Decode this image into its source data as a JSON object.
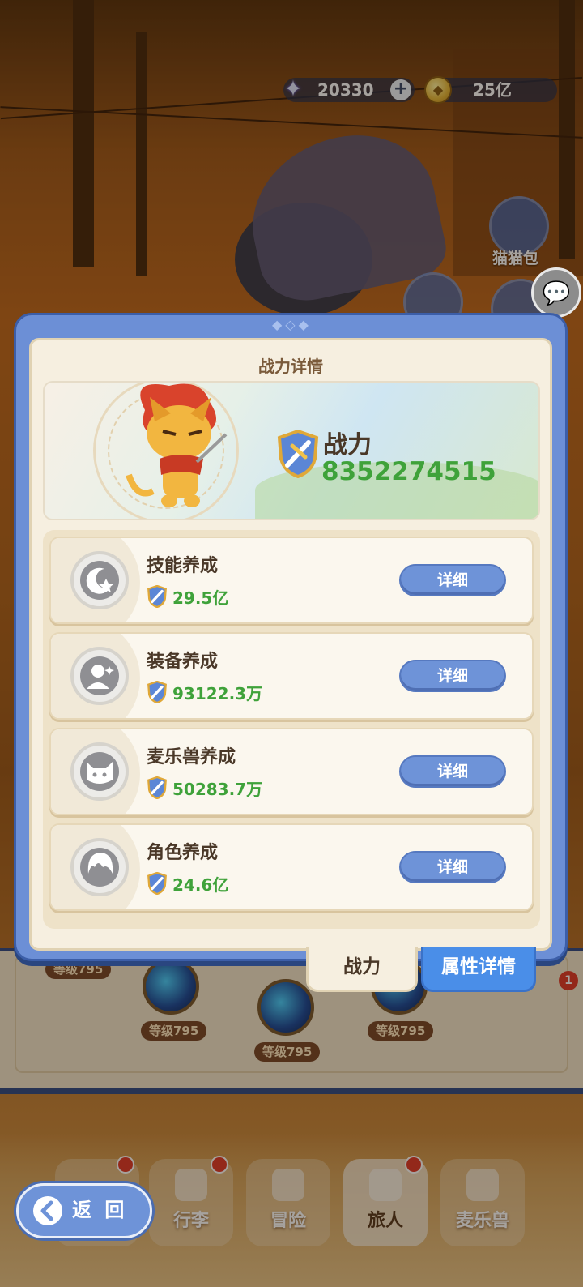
{
  "currency": {
    "gems": "20330",
    "gold": "25亿",
    "gem_icon": "star-gem-icon",
    "gold_icon": "gold-coin-icon"
  },
  "side_menu": {
    "cat_bag_label": "猫猫包"
  },
  "dialog": {
    "title": "战力详情",
    "power_label": "战力",
    "power_value": "8352274515",
    "rows": [
      {
        "name": "技能养成",
        "value": "29.5亿",
        "button": "详细",
        "icon": "moon-star-icon"
      },
      {
        "name": "装备养成",
        "value": "93122.3万",
        "button": "详细",
        "icon": "equipment-figure-icon"
      },
      {
        "name": "麦乐兽养成",
        "value": "50283.7万",
        "button": "详细",
        "icon": "beast-cat-icon"
      },
      {
        "name": "角色养成",
        "value": "24.6亿",
        "button": "详细",
        "icon": "character-head-icon"
      }
    ]
  },
  "dialog_tabs": {
    "power": "战力",
    "attributes": "属性详情"
  },
  "background": {
    "levels": [
      "等级795",
      "等级795",
      "等级795",
      "等级795"
    ],
    "badge_count": "1"
  },
  "back_button": "返 回",
  "tabbar": {
    "items": [
      "行李",
      "冒险",
      "旅人",
      "麦乐兽"
    ],
    "active": "旅人"
  },
  "colors": {
    "accent_blue": "#6e93d8",
    "power_green": "#3fa23a",
    "panel_cream": "#f6efe0"
  }
}
